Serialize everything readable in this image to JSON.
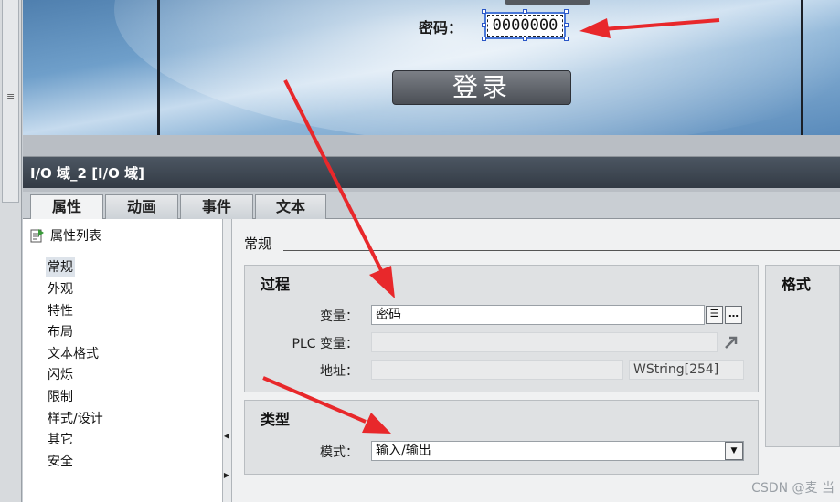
{
  "screen": {
    "password_label": "密码：",
    "password_value": "0000000",
    "login_button": "登录"
  },
  "inspector": {
    "title": "I/O 域_2 [I/O 域]",
    "tabs": [
      {
        "label": "属性",
        "active": true
      },
      {
        "label": "动画",
        "active": false
      },
      {
        "label": "事件",
        "active": false
      },
      {
        "label": "文本",
        "active": false
      }
    ],
    "list_header": "属性列表",
    "list_items": [
      {
        "label": "常规",
        "selected": true
      },
      {
        "label": "外观",
        "selected": false
      },
      {
        "label": "特性",
        "selected": false
      },
      {
        "label": "布局",
        "selected": false
      },
      {
        "label": "文本格式",
        "selected": false
      },
      {
        "label": "闪烁",
        "selected": false
      },
      {
        "label": "限制",
        "selected": false
      },
      {
        "label": "样式/设计",
        "selected": false
      },
      {
        "label": "其它",
        "selected": false
      },
      {
        "label": "安全",
        "selected": false
      }
    ],
    "section_title": "常规",
    "process": {
      "title": "过程",
      "variable_label": "变量：",
      "variable_value": "密码",
      "plc_variable_label": "PLC 变量：",
      "plc_variable_value": "",
      "address_label": "地址：",
      "address_value": "",
      "type_info": "WString[254]"
    },
    "type_group": {
      "title": "类型",
      "mode_label": "模式：",
      "mode_value": "输入/输出"
    },
    "format_group": {
      "title": "格式"
    }
  },
  "watermark": "CSDN @麦 当",
  "colors": {
    "annotation_arrow": "#e8282b",
    "selection_handle": "#2a56c6",
    "header_bg": "#3d4651"
  }
}
